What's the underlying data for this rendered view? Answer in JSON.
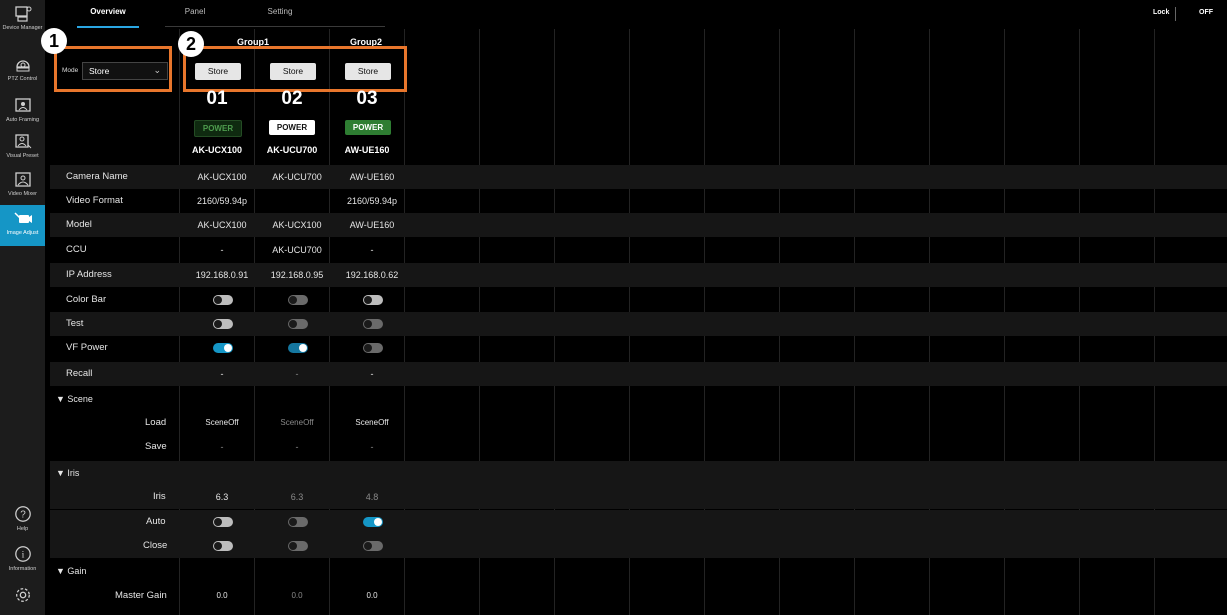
{
  "sidebar": {
    "items": [
      {
        "label": "Device Manager",
        "icon": "device-manager-icon"
      },
      {
        "label": "PTZ Control",
        "icon": "ptz-camera-icon"
      },
      {
        "label": "Auto Framing",
        "icon": "auto-framing-icon"
      },
      {
        "label": "Visual Preset",
        "icon": "visual-preset-icon"
      },
      {
        "label": "Video Mixer",
        "icon": "video-mixer-icon"
      },
      {
        "label": "Image Adjust",
        "icon": "image-adjust-icon"
      }
    ],
    "bottom": [
      {
        "label": "Help",
        "icon": "help-icon"
      },
      {
        "label": "Information",
        "icon": "information-icon"
      },
      {
        "label": "Settings",
        "icon": "gear-icon"
      }
    ]
  },
  "tabs": [
    "Overview",
    "Panel",
    "Setting"
  ],
  "lock": {
    "label": "Lock",
    "state": "OFF"
  },
  "mode": {
    "label": "Mode",
    "value": "Store"
  },
  "callouts": [
    "1",
    "2"
  ],
  "groups": [
    "Group1",
    "Group2"
  ],
  "store_buttons": [
    "Store",
    "Store",
    "Store"
  ],
  "cameras": [
    {
      "num": "01",
      "power": "POWER",
      "power_state": "dim",
      "model": "AK-UCX100"
    },
    {
      "num": "02",
      "power": "POWER",
      "power_state": "off",
      "model": "AK-UCU700"
    },
    {
      "num": "03",
      "power": "POWER",
      "power_state": "on",
      "model": "AW-UE160"
    }
  ],
  "rows": {
    "camera_name": {
      "label": "Camera Name",
      "values": [
        "AK-UCX100",
        "AK-UCU700",
        "AW-UE160"
      ]
    },
    "video_format": {
      "label": "Video Format",
      "values": [
        "2160/59.94p",
        "",
        "2160/59.94p"
      ]
    },
    "model": {
      "label": "Model",
      "values": [
        "AK-UCX100",
        "AK-UCX100",
        "AW-UE160"
      ]
    },
    "ccu": {
      "label": "CCU",
      "values": [
        "-",
        "AK-UCU700",
        "-"
      ]
    },
    "ip_address": {
      "label": "IP Address",
      "values": [
        "192.168.0.91",
        "192.168.0.95",
        "192.168.0.62"
      ]
    },
    "color_bar": {
      "label": "Color Bar"
    },
    "test": {
      "label": "Test"
    },
    "vf_power": {
      "label": "VF Power"
    },
    "recall": {
      "label": "Recall",
      "values": [
        "-",
        "-",
        "-"
      ]
    }
  },
  "scene": {
    "header": "▼ Scene",
    "load": {
      "label": "Load",
      "values": [
        "SceneOff",
        "SceneOff",
        "SceneOff"
      ]
    },
    "save": {
      "label": "Save",
      "values": [
        "-",
        "-",
        "-"
      ]
    }
  },
  "iris": {
    "header": "▼ Iris",
    "iris": {
      "label": "Iris",
      "values": [
        "6.3",
        "6.3",
        "4.8"
      ]
    },
    "auto": {
      "label": "Auto"
    },
    "close": {
      "label": "Close"
    }
  },
  "gain": {
    "header": "▼ Gain",
    "master_gain": {
      "label": "Master Gain",
      "values": [
        "0.0",
        "0.0",
        "0.0"
      ]
    }
  }
}
